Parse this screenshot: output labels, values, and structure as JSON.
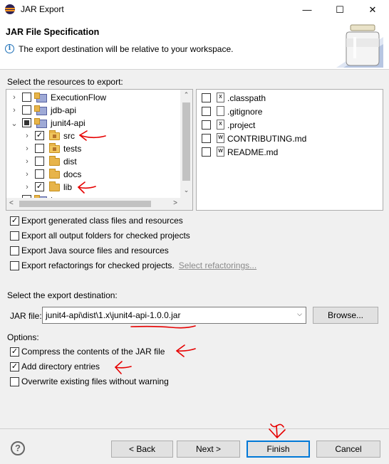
{
  "window": {
    "title": "JAR Export",
    "minimize": "—",
    "maximize": "☐",
    "close": "✕"
  },
  "banner": {
    "title": "JAR File Specification",
    "message": "The export destination will be relative to your workspace."
  },
  "resources_label": "Select the resources to export:",
  "tree": [
    {
      "label": "ExecutionFlow",
      "expanded": false,
      "check": "unchecked",
      "icon": "java-project-icon"
    },
    {
      "label": "jdb-api",
      "expanded": false,
      "check": "unchecked",
      "icon": "java-project-icon"
    },
    {
      "label": "junit4-api",
      "expanded": true,
      "check": "partial",
      "icon": "java-project-icon"
    },
    {
      "label": "src",
      "expanded": false,
      "check": "checked",
      "icon": "source-folder-icon"
    },
    {
      "label": "tests",
      "expanded": false,
      "check": "unchecked",
      "icon": "source-folder-icon"
    },
    {
      "label": "dist",
      "expanded": false,
      "check": "unchecked",
      "icon": "folder-icon"
    },
    {
      "label": "docs",
      "expanded": false,
      "check": "unchecked",
      "icon": "folder-icon"
    },
    {
      "label": "lib",
      "expanded": false,
      "check": "checked",
      "icon": "folder-icon"
    },
    {
      "label": "tron",
      "expanded": false,
      "check": "unchecked",
      "icon": "java-project-icon"
    }
  ],
  "files": [
    {
      "label": ".classpath",
      "check": "unchecked",
      "icon": "x-file-icon"
    },
    {
      "label": ".gitignore",
      "check": "unchecked",
      "icon": "text-file-icon"
    },
    {
      "label": ".project",
      "check": "unchecked",
      "icon": "x-file-icon"
    },
    {
      "label": "CONTRIBUTING.md",
      "check": "unchecked",
      "icon": "word-file-icon"
    },
    {
      "label": "README.md",
      "check": "unchecked",
      "icon": "word-file-icon"
    }
  ],
  "export_options": [
    {
      "label": "Export generated class files and resources",
      "checked": true
    },
    {
      "label": "Export all output folders for checked projects",
      "checked": false
    },
    {
      "label": "Export Java source files and resources",
      "checked": false
    },
    {
      "label": "Export refactorings for checked projects.",
      "checked": false,
      "link": "Select refactorings..."
    }
  ],
  "destination": {
    "label": "Select the export destination:",
    "jar_label": "JAR file:",
    "jar_value": "junit4-api\\dist\\1.x\\junit4-api-1.0.0.jar",
    "browse": "Browse..."
  },
  "options": {
    "label": "Options:",
    "items": [
      {
        "label": "Compress the contents of the JAR file",
        "checked": true
      },
      {
        "label": "Add directory entries",
        "checked": true
      },
      {
        "label": "Overwrite existing files without warning",
        "checked": false
      }
    ]
  },
  "buttons": {
    "back": "< Back",
    "next": "Next >",
    "finish": "Finish",
    "cancel": "Cancel",
    "help": "?"
  },
  "colors": {
    "annotation": "#e60000",
    "accent": "#0078d7"
  }
}
